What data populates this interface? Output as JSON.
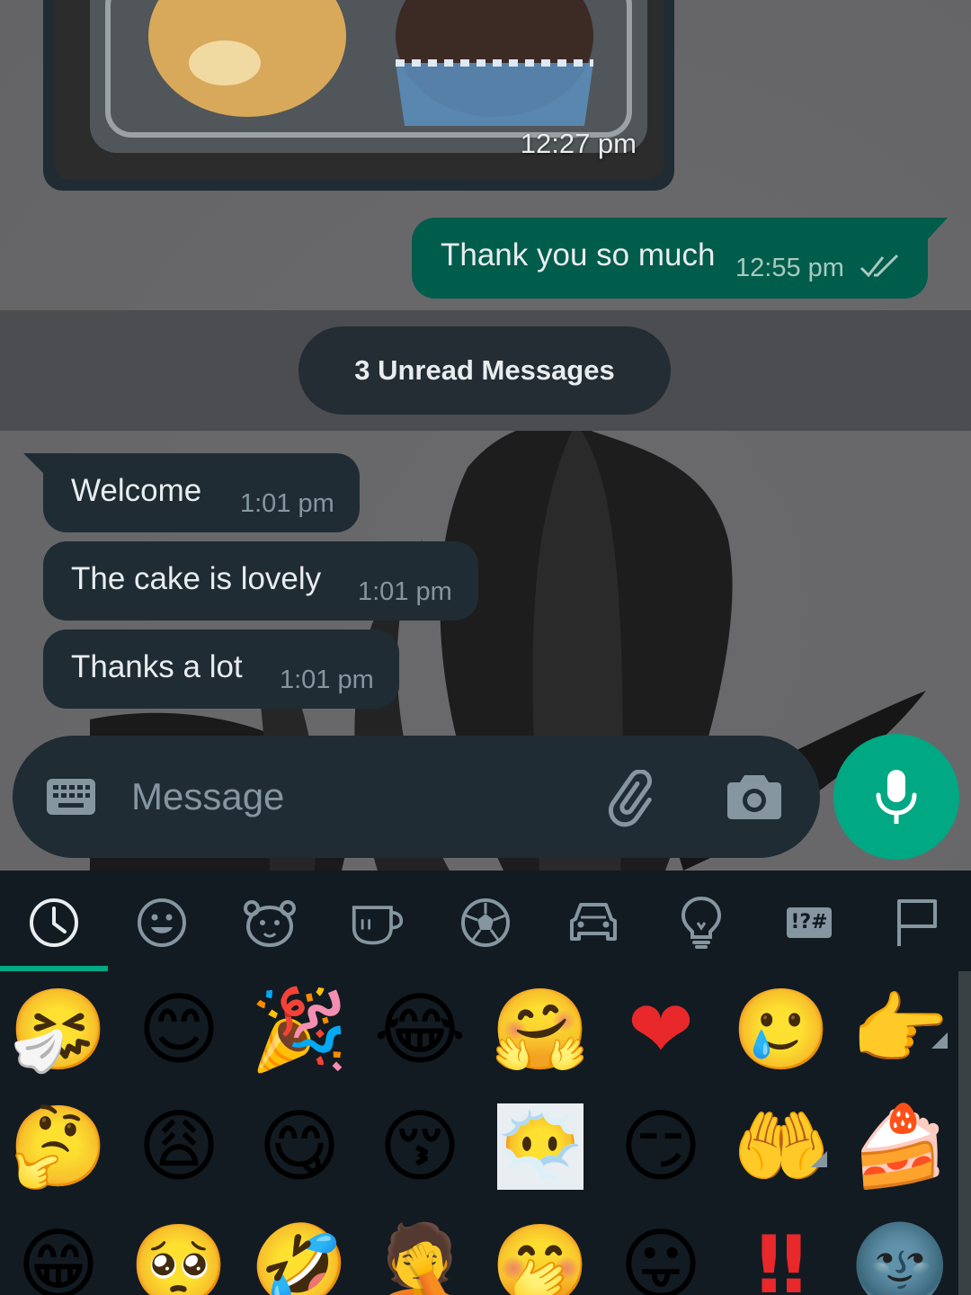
{
  "chat": {
    "image_message": {
      "time": "12:27 pm"
    },
    "outgoing": {
      "text": "Thank you so much",
      "time": "12:55 pm"
    },
    "unread_banner": "3 Unread Messages",
    "incoming": [
      {
        "text": "Welcome",
        "time": "1:01 pm"
      },
      {
        "text": "The cake is lovely",
        "time": "1:01 pm"
      },
      {
        "text": "Thanks a lot",
        "time": "1:01 pm"
      }
    ]
  },
  "input": {
    "placeholder": "Message",
    "icons": [
      "keyboard-icon",
      "attach-icon",
      "camera-icon",
      "mic-icon"
    ]
  },
  "emoji_panel": {
    "tabs": [
      "recent",
      "smileys",
      "animals",
      "food",
      "activity",
      "travel",
      "objects",
      "symbols",
      "flags"
    ],
    "symbols_tab_label": "!?#",
    "selected_tab": "recent",
    "rows": [
      [
        "🤧",
        "😊",
        "🎉",
        "😂",
        "🤗",
        "❤",
        "🥲",
        "👉"
      ],
      [
        "🤔",
        "😩",
        "😋",
        "😚",
        "😶‍🌫️",
        "😏",
        "🤲",
        "🍰"
      ],
      [
        "😁",
        "🥺",
        "🤣",
        "🤦",
        "🤭",
        "😛",
        "‼",
        "🌚"
      ]
    ]
  },
  "colors": {
    "accent": "#00a884",
    "outgoing_bubble": "#005c4b",
    "incoming_bubble": "#1f2c34",
    "panel_bg": "#121b22"
  }
}
